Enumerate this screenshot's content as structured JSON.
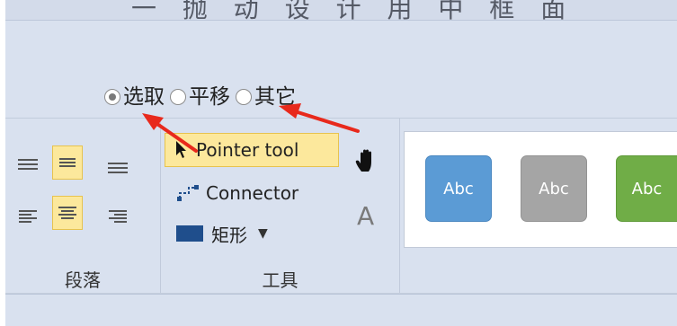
{
  "window": {
    "title_fragment": "一 抛 动 设 计 用 中 框 面"
  },
  "radio_group": {
    "options": [
      {
        "label": "选取",
        "checked": true
      },
      {
        "label": "平移",
        "checked": false
      },
      {
        "label": "其它",
        "checked": false
      }
    ]
  },
  "paragraph_group": {
    "caption": "段落",
    "active_alignments": [
      "middle-center",
      "bottom-center"
    ]
  },
  "tools_group": {
    "caption": "工具",
    "pointer_tool_label": "Pointer tool",
    "connector_label": "Connector",
    "shape_label": "矩形",
    "text_tool_glyph": "A"
  },
  "style_gallery": {
    "swatches": [
      {
        "label": "Abc",
        "color": "#5b9bd5",
        "border": "#4a87c0"
      },
      {
        "label": "Abc",
        "color": "#a5a5a5",
        "border": "#939393"
      },
      {
        "label": "Abc",
        "color": "#70ad47",
        "border": "#5f9a3a"
      }
    ]
  },
  "colors": {
    "ribbon_bg": "#d9e1ef",
    "active_highlight": "#fce89c",
    "annotation_arrow": "#e8291c",
    "shape_fill": "#1f4e8c"
  },
  "icons": {
    "pointer": "arrow-cursor-icon",
    "connector": "connector-icon",
    "shape": "rectangle-icon",
    "pan": "hand-icon",
    "text": "text-tool-icon"
  }
}
